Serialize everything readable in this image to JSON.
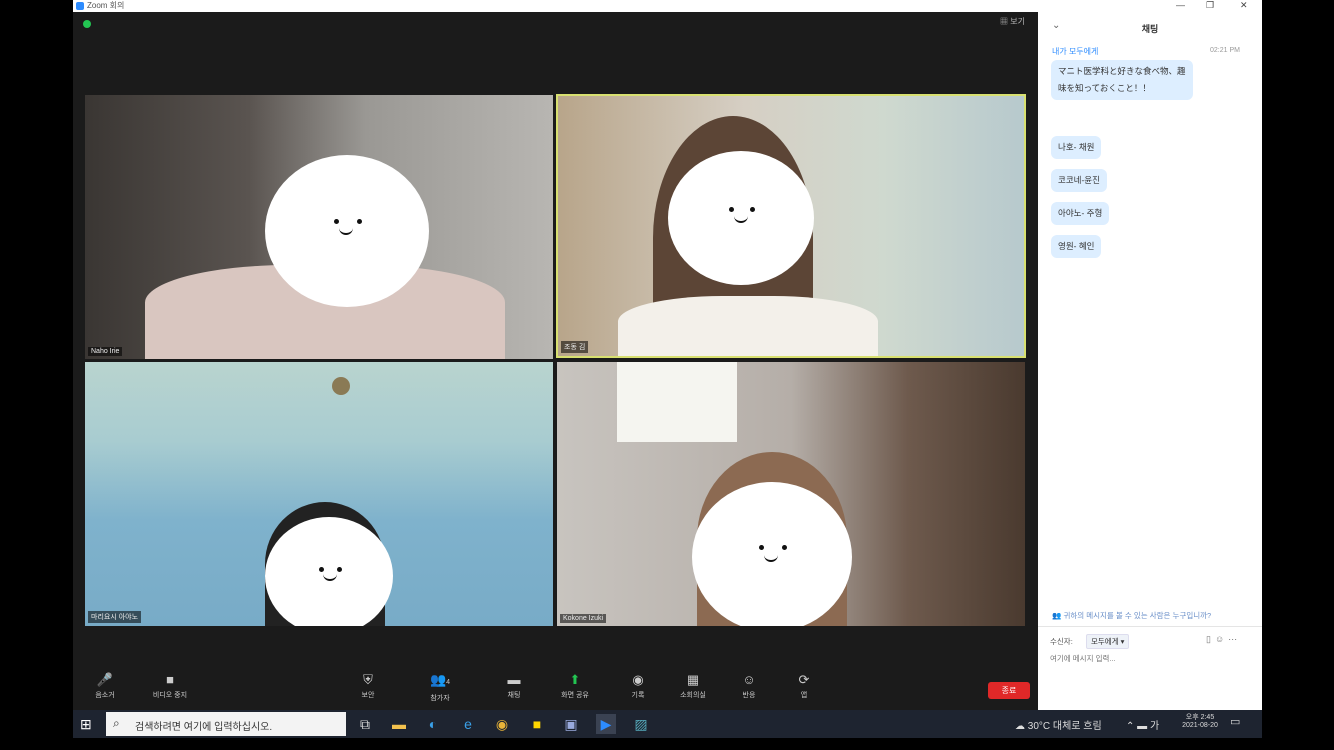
{
  "window": {
    "title": "Zoom 회의"
  },
  "topbar": {
    "view_label": "▦ 보기"
  },
  "participants": [
    {
      "name": "Naho Irie"
    },
    {
      "name": "조동 김"
    },
    {
      "name": "마리요시 아야노"
    },
    {
      "name": "Kokone Izuki"
    }
  ],
  "toolbar": {
    "mute": "음소거",
    "video": "비디오 중지",
    "security": "보안",
    "participants": "참가자",
    "participant_count": "4",
    "chat": "채팅",
    "share": "화면 공유",
    "record": "기록",
    "breakout": "소회의실",
    "reactions": "반응",
    "apps": "앱",
    "end": "종료"
  },
  "chat": {
    "title": "채팅",
    "from": "내가 모두에게",
    "time": "02:21 PM",
    "messages": [
      "マニト医学科と好きな食べ物、趣味を知っておくこと！！",
      "나호- 채원",
      "코코네-윤진",
      "아야노- 주형",
      "영원- 혜인"
    ],
    "notice": "귀하의 메시지를 볼 수 있는 사람은 누구입니까?",
    "to_label": "수신자:",
    "to_value": "모두에게 ▾",
    "input_placeholder": "여기에 메시지 입력..."
  },
  "taskbar": {
    "search_placeholder": "검색하려면 여기에 입력하십시오.",
    "weather": "30°C 대체로 흐림",
    "ime": "가",
    "time": "오후 2:45",
    "date": "2021-08-20"
  },
  "colors": {
    "zoom_blue": "#2d8cff",
    "end_red": "#e02828",
    "active_speaker": "#d8e070",
    "share_green": "#23c552"
  }
}
